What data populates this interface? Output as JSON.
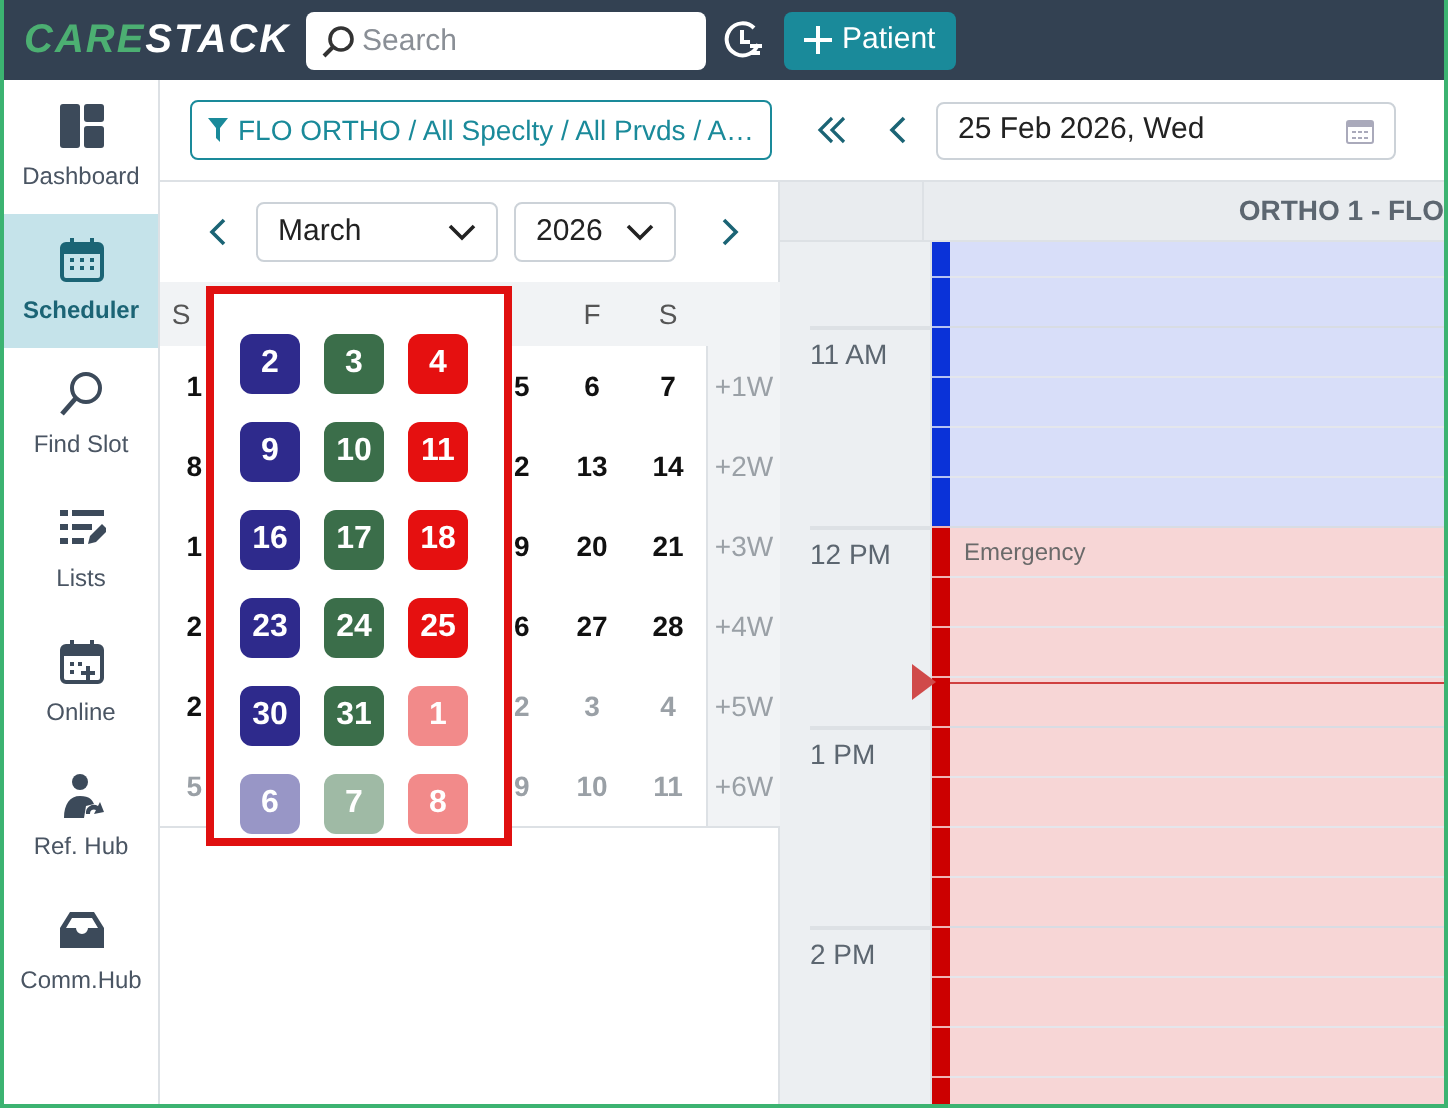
{
  "header": {
    "logo": [
      {
        "text": "CARE",
        "color": "#4caf72"
      },
      {
        "text": "STACK",
        "color": "#ffffff"
      }
    ],
    "search": {
      "placeholder": "Search"
    },
    "patient_button": "Patient"
  },
  "sidebar": {
    "items": [
      {
        "label": "Dashboard",
        "selected": false
      },
      {
        "label": "Scheduler",
        "selected": true
      },
      {
        "label": "Find Slot",
        "selected": false
      },
      {
        "label": "Lists",
        "selected": false
      },
      {
        "label": "Online",
        "selected": false
      },
      {
        "label": "Ref. Hub",
        "selected": false
      },
      {
        "label": "Comm.Hub",
        "selected": false
      }
    ]
  },
  "toolbar": {
    "filter": "FLO ORTHO / All Speclty / All Prvds / A…",
    "date": "25 Feb 2026, Wed"
  },
  "mini_calendar": {
    "month": "March",
    "year": "2026",
    "weekday_headers": {
      "sunday": "S",
      "friday": "F",
      "saturday": "S"
    },
    "rows": [
      {
        "sunday": {
          "text": "1",
          "other_month": false
        },
        "thursday": {
          "text": "5",
          "other_month": false
        },
        "friday": {
          "text": "6",
          "other_month": false
        },
        "saturday": {
          "text": "7",
          "other_month": false
        },
        "week": "+1W"
      },
      {
        "sunday": {
          "text": "8",
          "other_month": false
        },
        "thursday": {
          "text": "2",
          "other_month": false
        },
        "friday": {
          "text": "13",
          "other_month": false
        },
        "saturday": {
          "text": "14",
          "other_month": false
        },
        "week": "+2W"
      },
      {
        "sunday": {
          "text": "1",
          "other_month": false
        },
        "thursday": {
          "text": "9",
          "other_month": false
        },
        "friday": {
          "text": "20",
          "other_month": false
        },
        "saturday": {
          "text": "21",
          "other_month": false
        },
        "week": "+3W"
      },
      {
        "sunday": {
          "text": "2",
          "other_month": false
        },
        "thursday": {
          "text": "6",
          "other_month": false
        },
        "friday": {
          "text": "27",
          "other_month": false
        },
        "saturday": {
          "text": "28",
          "other_month": false
        },
        "week": "+4W"
      },
      {
        "sunday": {
          "text": "2",
          "other_month": false
        },
        "thursday": {
          "text": "2",
          "other_month": true
        },
        "friday": {
          "text": "3",
          "other_month": true
        },
        "saturday": {
          "text": "4",
          "other_month": true
        },
        "week": "+5W"
      },
      {
        "sunday": {
          "text": "5",
          "other_month": true
        },
        "thursday": {
          "text": "9",
          "other_month": true
        },
        "friday": {
          "text": "10",
          "other_month": true
        },
        "saturday": {
          "text": "11",
          "other_month": true
        },
        "week": "+6W"
      }
    ]
  },
  "day_overlay": {
    "rows": [
      [
        {
          "text": "2",
          "color": "#2e2a8c"
        },
        {
          "text": "3",
          "color": "#3b6e4a"
        },
        {
          "text": "4",
          "color": "#e51010"
        }
      ],
      [
        {
          "text": "9",
          "color": "#2e2a8c"
        },
        {
          "text": "10",
          "color": "#3b6e4a"
        },
        {
          "text": "11",
          "color": "#e51010"
        }
      ],
      [
        {
          "text": "16",
          "color": "#2e2a8c"
        },
        {
          "text": "17",
          "color": "#3b6e4a"
        },
        {
          "text": "18",
          "color": "#e51010"
        }
      ],
      [
        {
          "text": "23",
          "color": "#2e2a8c"
        },
        {
          "text": "24",
          "color": "#3b6e4a"
        },
        {
          "text": "25",
          "color": "#e51010"
        }
      ],
      [
        {
          "text": "30",
          "color": "#2e2a8c"
        },
        {
          "text": "31",
          "color": "#3b6e4a"
        },
        {
          "text": "1",
          "color": "#f28a8a"
        }
      ],
      [
        {
          "text": "6",
          "color": "#9896c6"
        },
        {
          "text": "7",
          "color": "#9fbaa5"
        },
        {
          "text": "8",
          "color": "#f28a8a"
        }
      ]
    ]
  },
  "schedule": {
    "column_header": "ORTHO 1 - FLO",
    "times": [
      "11 AM",
      "12 PM",
      "1 PM",
      "2 PM"
    ],
    "blocks": [
      {
        "color": "#0a32d8"
      },
      {
        "label": "Emergency",
        "color": "#cc0000"
      }
    ]
  }
}
